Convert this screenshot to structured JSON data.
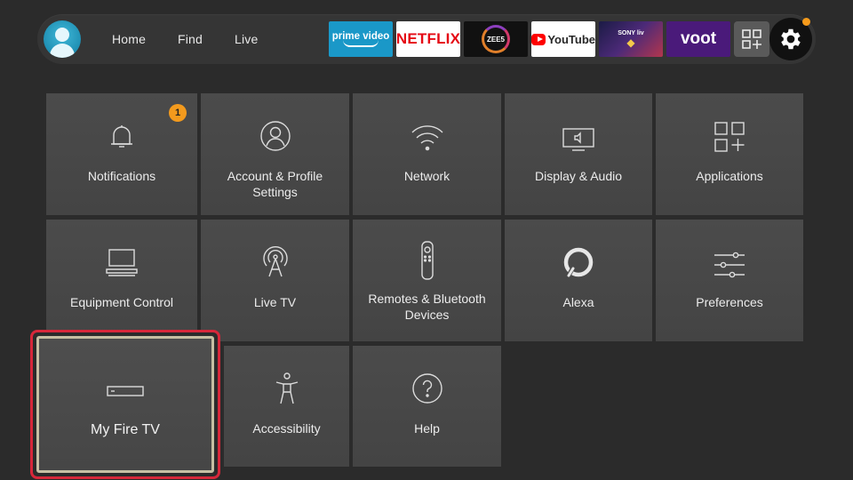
{
  "header": {
    "nav": [
      {
        "label": "Home"
      },
      {
        "label": "Find"
      },
      {
        "label": "Live"
      }
    ],
    "apps": [
      {
        "label": "prime video",
        "icon": "prime-video-logo"
      },
      {
        "label": "NETFLIX",
        "icon": "netflix-logo"
      },
      {
        "label": "ZEE5",
        "icon": "zee5-logo"
      },
      {
        "label": "YouTube",
        "icon": "youtube-logo"
      },
      {
        "label": "SONY liv",
        "icon": "sonyliv-logo"
      },
      {
        "label": "voot",
        "icon": "voot-logo"
      }
    ],
    "apps_grid_icon": "apps-grid-icon",
    "settings_icon": "gear-icon",
    "accent_color": "#f59a1b"
  },
  "settings": {
    "tiles": [
      {
        "label": "Notifications",
        "icon": "bell-icon",
        "badge": "1"
      },
      {
        "label": "Account & Profile Settings",
        "icon": "profile-icon"
      },
      {
        "label": "Network",
        "icon": "wifi-icon"
      },
      {
        "label": "Display & Audio",
        "icon": "display-audio-icon"
      },
      {
        "label": "Applications",
        "icon": "applications-icon"
      },
      {
        "label": "Equipment Control",
        "icon": "equipment-icon"
      },
      {
        "label": "Live TV",
        "icon": "antenna-icon"
      },
      {
        "label": "Remotes & Bluetooth Devices",
        "icon": "remote-icon"
      },
      {
        "label": "Alexa",
        "icon": "alexa-icon"
      },
      {
        "label": "Preferences",
        "icon": "sliders-icon"
      },
      {
        "label": "My Fire TV",
        "icon": "fire-tv-device-icon",
        "focused": true
      },
      {
        "label": "Accessibility",
        "icon": "accessibility-icon"
      },
      {
        "label": "Help",
        "icon": "help-icon"
      }
    ],
    "focus_color": "#d7273a"
  }
}
